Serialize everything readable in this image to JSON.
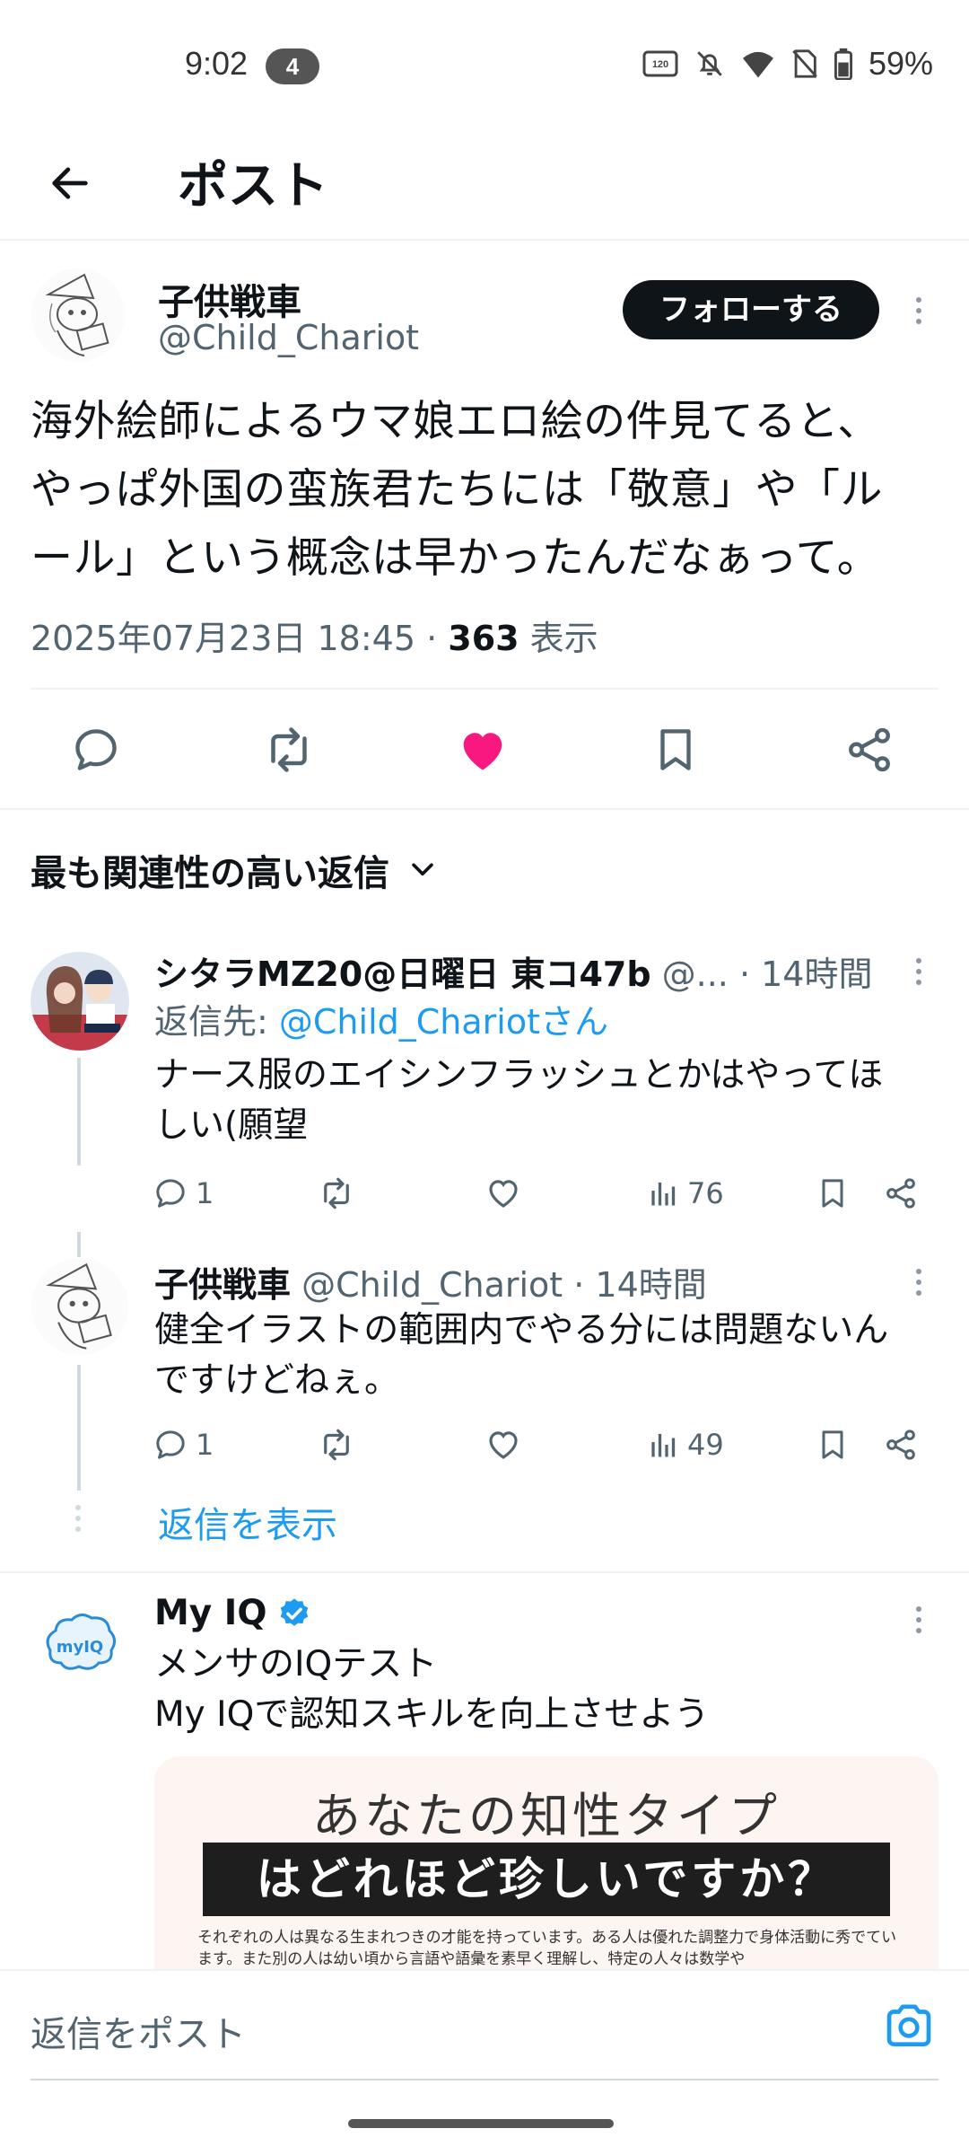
{
  "status": {
    "time": "9:02",
    "notification_count": "4",
    "battery": "59%",
    "refresh_label": "120"
  },
  "header": {
    "title": "ポスト"
  },
  "post": {
    "author_name": "子供戦車",
    "handle": "@Child_Chariot",
    "follow_label": "フォローする",
    "text_line1": "海外絵師によるウマ娘エロ絵の件見てると、",
    "text_line2": "やっぱ外国の蛮族君たちには「敬意」や「ル",
    "text_line3": "ール」という概念は早かったんだなぁって。",
    "timestamp": "2025年07月23日 18:45 · ",
    "views_count": "363",
    "views_label": " 表示",
    "liked": true,
    "accent_color": "#f91880"
  },
  "sort": {
    "label": "最も関連性の高い返信"
  },
  "replies": [
    {
      "name": "シタラMZ20@日曜日 東コ47b",
      "handle": " @...",
      "time": " · 14時間",
      "reply_to_prefix": "返信先: ",
      "reply_to_handle": "@Child_Chariotさん",
      "text_line1": "ナース服のエイシンフラッシュとかはやってほ",
      "text_line2": "しい(願望",
      "comments": "1",
      "views": "76"
    },
    {
      "name": "子供戦車",
      "handle": " @Child_Chariot · 14時間",
      "text_line1": "健全イラストの範囲内でやる分には問題ないん",
      "text_line2": "ですけどねぇ。",
      "comments": "1",
      "views": "49"
    }
  ],
  "show_replies_label": "返信を表示",
  "ad": {
    "name": "My IQ",
    "logo_text": "myIQ",
    "line1": "メンサのIQテスト",
    "line2": "My IQで認知スキルを向上させよう",
    "image_title": "あなたの知性タイプ",
    "image_banner": "はどれほど珍しいですか？",
    "image_body": "それぞれの人は異なる生まれつきの才能を持っています。ある人は優れた調整力で身体活動に秀でています。また別の人は幼い頃から言語や語彙を素早く理解し、特定の人々は数学や"
  },
  "compose": {
    "placeholder": "返信をポスト"
  }
}
